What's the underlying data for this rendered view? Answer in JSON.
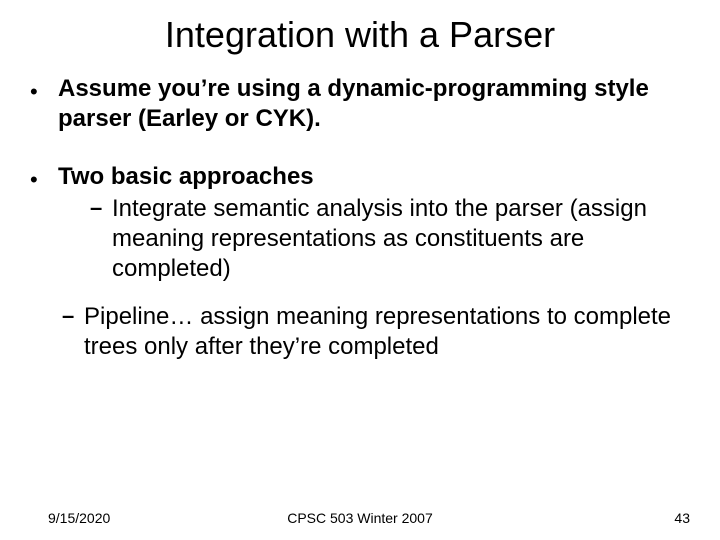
{
  "title": "Integration with a Parser",
  "bullets": [
    {
      "text_prefix": "Assume you’re using a dynamic-programming style parser (Earley or CYK)."
    },
    {
      "text_prefix": "Two basic approaches",
      "subs": [
        {
          "lead": "Integrate",
          "rest": " semantic analysis into the parser (assign meaning representations as constituents are completed)"
        },
        {
          "lead": "Pipeline…",
          "rest": " assign meaning representations to complete trees only after they’re completed"
        }
      ]
    }
  ],
  "footer": {
    "date": "9/15/2020",
    "center": "CPSC 503 Winter 2007",
    "page": "43"
  }
}
